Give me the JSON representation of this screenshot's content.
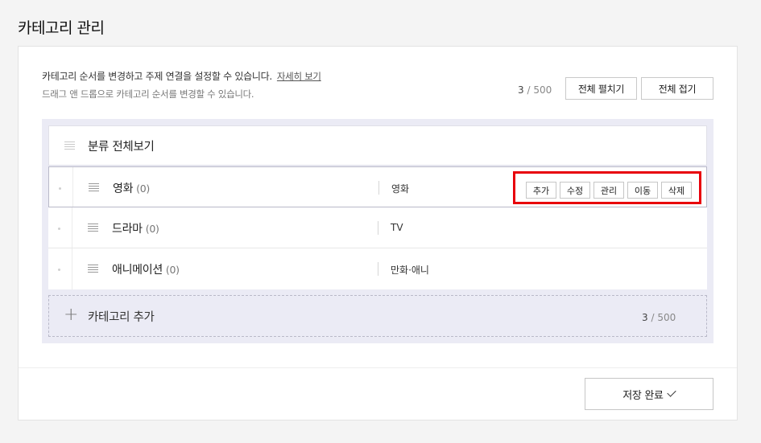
{
  "page": {
    "title": "카테고리 관리"
  },
  "header": {
    "description": "카테고리 순서를 변경하고 주제 연결을 설정할 수 있습니다.",
    "help_link": "자세히 보기",
    "sub_description": "드래그 앤 드롭으로 카테고리 순서를 변경할 수 있습니다.",
    "count": "3",
    "max": "/ 500",
    "expand_all": "전체 펼치기",
    "collapse_all": "전체 접기"
  },
  "tree": {
    "root_label": "분류 전체보기",
    "categories": [
      {
        "name": "영화",
        "count": "(0)",
        "topic": "영화"
      },
      {
        "name": "드라마",
        "count": "(0)",
        "topic": "TV"
      },
      {
        "name": "애니메이션",
        "count": "(0)",
        "topic": "만화·애니"
      }
    ],
    "actions": {
      "add": "추가",
      "edit": "수정",
      "manage": "관리",
      "move": "이동",
      "delete": "삭제"
    },
    "add_category": {
      "label": "카테고리 추가",
      "count": "3",
      "max": "/ 500"
    }
  },
  "footer": {
    "save": "저장 완료"
  },
  "colors": {
    "highlight": "#e8000b",
    "tree_bg": "#ebebf5"
  }
}
